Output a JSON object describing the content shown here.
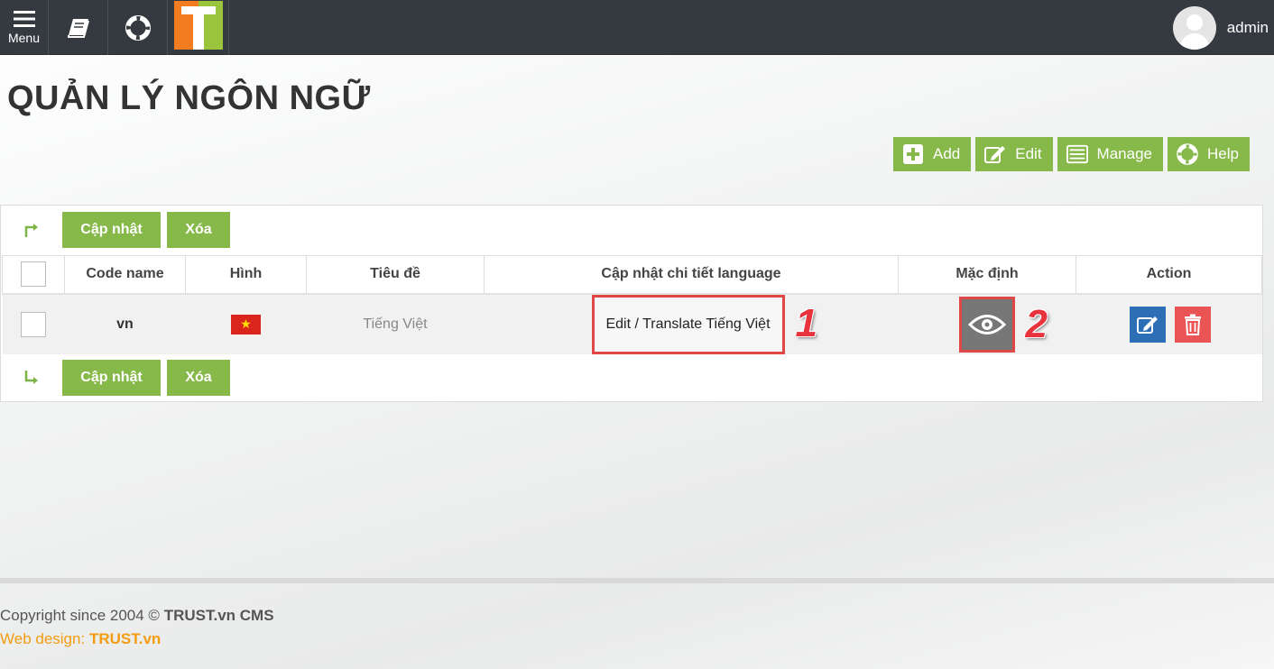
{
  "topbar": {
    "menu_label": "Menu",
    "user_name": "admin"
  },
  "page": {
    "title": "QUẢN LÝ NGÔN NGỮ"
  },
  "actions": {
    "add": "Add",
    "edit": "Edit",
    "manage": "Manage",
    "help": "Help"
  },
  "bulk": {
    "update": "Cập nhật",
    "delete": "Xóa"
  },
  "table": {
    "headers": [
      "Code name",
      "Hình",
      "Tiêu đề",
      "Cập nhật chi tiết language",
      "Mặc định",
      "Action"
    ],
    "rows": [
      {
        "code": "vn",
        "title": "Tiếng Việt",
        "translate_link": "Edit / Translate Tiếng Việt"
      }
    ]
  },
  "annotations": {
    "marker1": "1",
    "marker2": "2"
  },
  "footer": {
    "copyright_prefix": "Copyright since 2004 ©",
    "copyright_brand": "TRUST.vn CMS",
    "webdesign_prefix": "Web design:",
    "webdesign_brand": "TRUST.vn"
  },
  "colors": {
    "topbar": "#343a40",
    "green": "#87b94a",
    "edit_blue": "#2d6fb6",
    "delete_red": "#ea5455",
    "highlight_red": "#e04848",
    "footer_orange": "#f39c12"
  }
}
